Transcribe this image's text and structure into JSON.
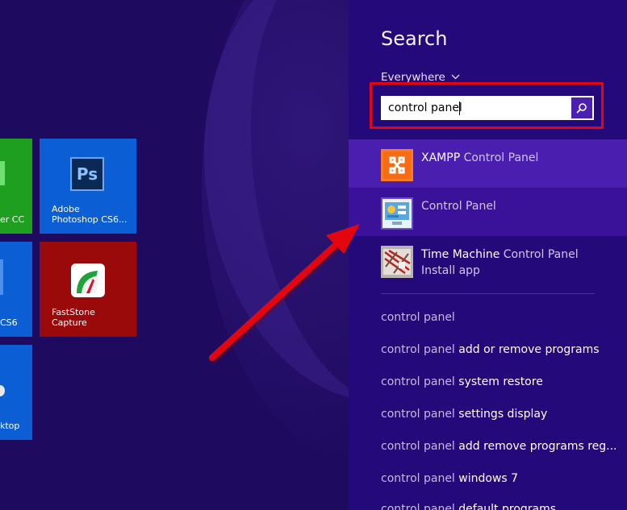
{
  "start_screen": {
    "tiles": [
      {
        "id": "tile-green",
        "label": "er CC",
        "color": "#1e9e1e"
      },
      {
        "id": "tile-photoshop",
        "label": "Adobe\nPhotoshop CS6...",
        "color": "#0a5cd0",
        "icon_text": "Ps"
      },
      {
        "id": "tile-blue-mid",
        "label": "CS6",
        "color": "#0a5cd0"
      },
      {
        "id": "tile-faststone",
        "label": "FastStone\nCapture",
        "color": "#9a0b0b"
      },
      {
        "id": "tile-desktop",
        "label": "ktop",
        "color": "#0a5cd0"
      }
    ]
  },
  "search": {
    "title": "Search",
    "scope": "Everywhere",
    "query": "control panel",
    "results": [
      {
        "highlight": "XAMPP",
        "rest": " Control Panel",
        "subtitle": "",
        "icon": "xampp-icon"
      },
      {
        "highlight": "",
        "rest": "Control Panel",
        "subtitle": "",
        "icon": "control-panel-icon"
      },
      {
        "highlight": "Time Machine",
        "rest": " Control Panel",
        "subtitle": "Install app",
        "icon": "time-machine-icon"
      }
    ],
    "suggestions": [
      {
        "query": "control panel",
        "term": ""
      },
      {
        "query": "control panel",
        "term": " add or remove programs"
      },
      {
        "query": "control panel",
        "term": " system restore"
      },
      {
        "query": "control panel",
        "term": " settings display"
      },
      {
        "query": "control panel",
        "term": " add remove programs reg..."
      },
      {
        "query": "control panel",
        "term": " windows 7"
      },
      {
        "query": "control panel",
        "term": " default programs"
      }
    ]
  },
  "colors": {
    "start_bg": "#1e0b60",
    "pane_bg": "#24097a",
    "result_selected": "#4a1fb0",
    "result_hover": "#3a129a",
    "annotation_red": "#e3060e"
  }
}
